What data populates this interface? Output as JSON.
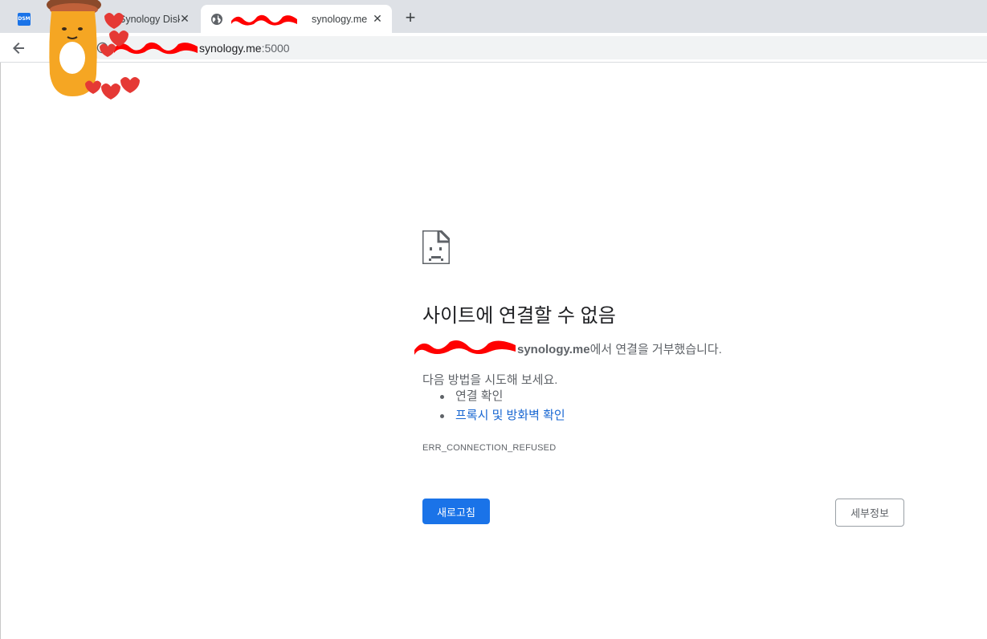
{
  "tabs": [
    {
      "title": "Synology Disk",
      "favicon": "DSM",
      "favicon_icon": "dsm-icon",
      "active": false
    },
    {
      "title": "synology.me",
      "favicon_icon": "globe-icon",
      "active": true
    }
  ],
  "tab_close_glyph": "✕",
  "new_tab_glyph": "+",
  "omnibox": {
    "host": "synology.me",
    "port": ":5000",
    "icons": [
      "info-icon"
    ]
  },
  "error": {
    "icon": "sad-document-icon",
    "title": "사이트에 연결할 수 없음",
    "host": "synology.me",
    "message": "에서 연결을 거부했습니다.",
    "try_text": "다음 방법을 시도해 보세요.",
    "suggestions": [
      "연결 확인",
      "프록시 및 방화벽 확인"
    ],
    "code": "ERR_CONNECTION_REFUSED"
  },
  "buttons": {
    "reload": "새로고침",
    "details": "세부정보"
  },
  "colors": {
    "primary": "#1a73e8",
    "link": "#1967d2",
    "redaction": "#ff0000"
  }
}
